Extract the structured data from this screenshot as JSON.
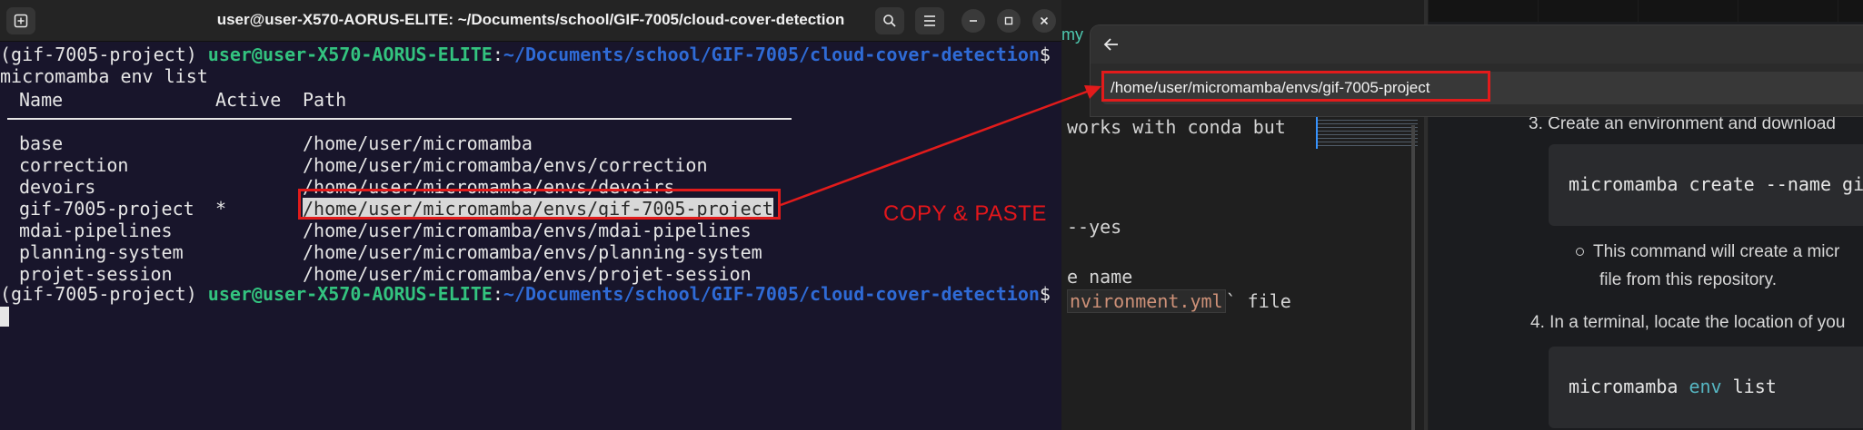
{
  "terminal": {
    "title": "user@user-X570-AORUS-ELITE: ~/Documents/school/GIF-7005/cloud-cover-detection",
    "prompt": {
      "env": "(gif-7005-project) ",
      "user": "user@user-X570-AORUS-ELITE",
      "colon": ":",
      "cwd": "~/Documents/school/GIF-7005/cloud-cover-detection",
      "symbol": "$"
    },
    "command": "micromamba env list",
    "headers": {
      "name": "Name",
      "active": "Active",
      "path": "Path"
    },
    "envs": [
      {
        "name": "base",
        "active": "",
        "path": "/home/user/micromamba"
      },
      {
        "name": "correction",
        "active": "",
        "path": "/home/user/micromamba/envs/correction"
      },
      {
        "name": "devoirs",
        "active": "",
        "path": "/home/user/micromamba/envs/devoirs"
      },
      {
        "name": "gif-7005-project",
        "active": "*",
        "path": "/home/user/micromamba/envs/gif-7005-project"
      },
      {
        "name": "mdai-pipelines",
        "active": "",
        "path": "/home/user/micromamba/envs/mdai-pipelines"
      },
      {
        "name": "planning-system",
        "active": "",
        "path": "/home/user/micromamba/envs/planning-system"
      },
      {
        "name": "projet-session",
        "active": "",
        "path": "/home/user/micromamba/envs/projet-session"
      }
    ]
  },
  "chooser": {
    "location": "/home/user/micromamba/envs/gif-7005-project"
  },
  "annotation": {
    "label": "COPY & PASTE",
    "color": "#e21b1b"
  },
  "editor": {
    "tab_fragment": "my",
    "line1": "works with conda but",
    "line2": "--yes",
    "line3": "e name",
    "line4_str": "nvironment.yml",
    "line4_rest": "` file"
  },
  "docs": {
    "step3": "3. Create an environment and download",
    "code1": "micromamba create --name gi",
    "bullet": "This command will create a micr",
    "bullet_cont": "file from this repository.",
    "step4": "4. In a terminal, locate the location of you",
    "code2_a": "micromamba ",
    "code2_kw": "env",
    "code2_b": " list"
  }
}
